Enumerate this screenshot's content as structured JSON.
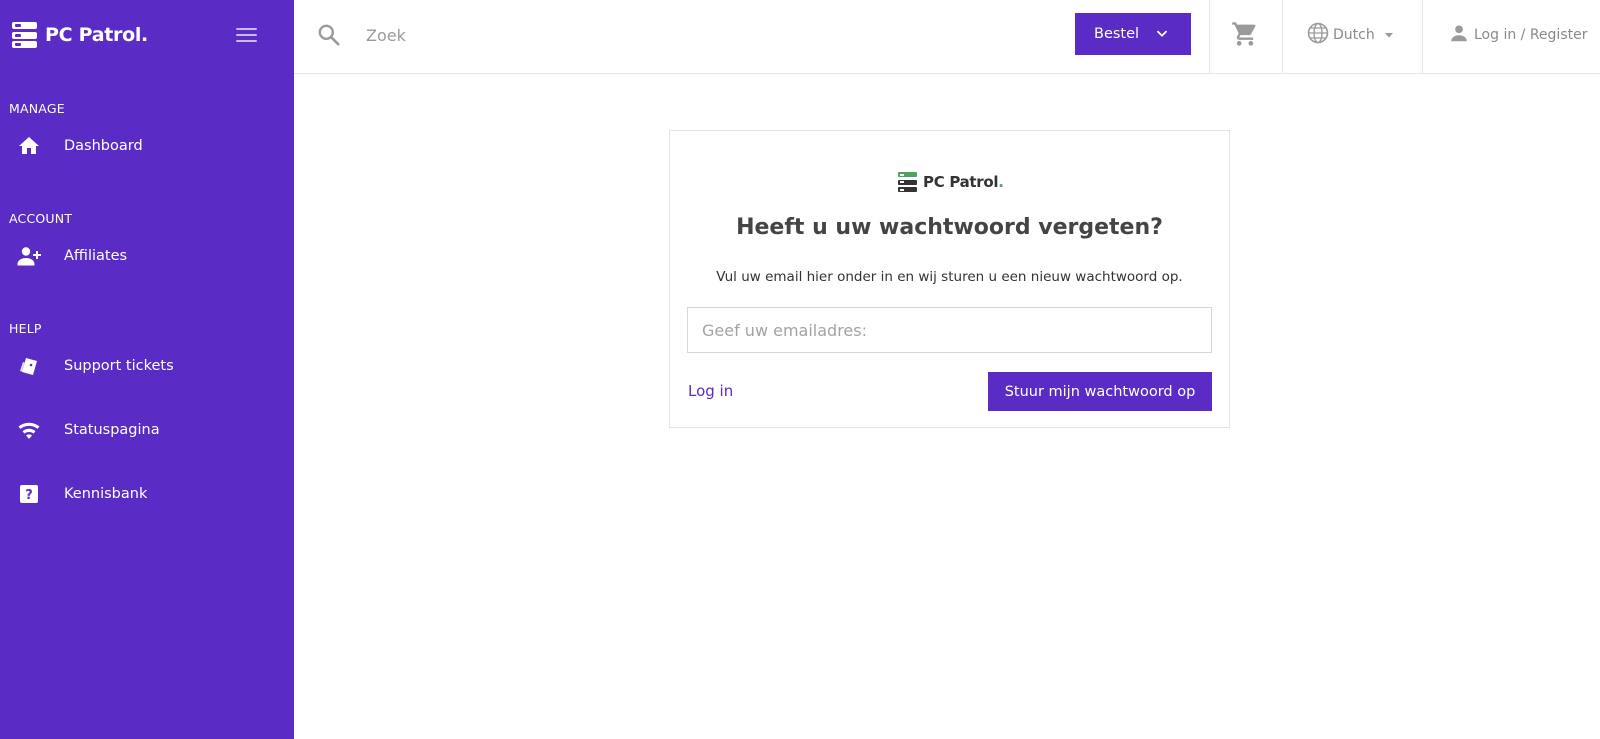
{
  "brand": {
    "name": "PC Patrol",
    "dot": ".",
    "accent": "#5b2bc6",
    "dot_color": "#4fa35e"
  },
  "sidebar": {
    "sections": [
      {
        "title": "MANAGE",
        "items": [
          {
            "label": "Dashboard",
            "icon": "home-icon"
          }
        ]
      },
      {
        "title": "ACCOUNT",
        "items": [
          {
            "label": "Affiliates",
            "icon": "person-add-icon"
          }
        ]
      },
      {
        "title": "HELP",
        "items": [
          {
            "label": "Support tickets",
            "icon": "ticket-icon"
          },
          {
            "label": "Statuspagina",
            "icon": "wifi-icon"
          },
          {
            "label": "Kennisbank",
            "icon": "help-icon"
          }
        ]
      }
    ]
  },
  "topbar": {
    "search_placeholder": "Zoek",
    "order_label": "Bestel",
    "language": "Dutch",
    "login_label": "Log in / Register"
  },
  "card": {
    "title": "Heeft u uw wachtwoord vergeten?",
    "description": "Vul uw email hier onder in en wij sturen u een nieuw wachtwoord op.",
    "email_placeholder": "Geef uw emailadres:",
    "email_value": "",
    "login_link": "Log in",
    "submit_label": "Stuur mijn wachtwoord op"
  }
}
